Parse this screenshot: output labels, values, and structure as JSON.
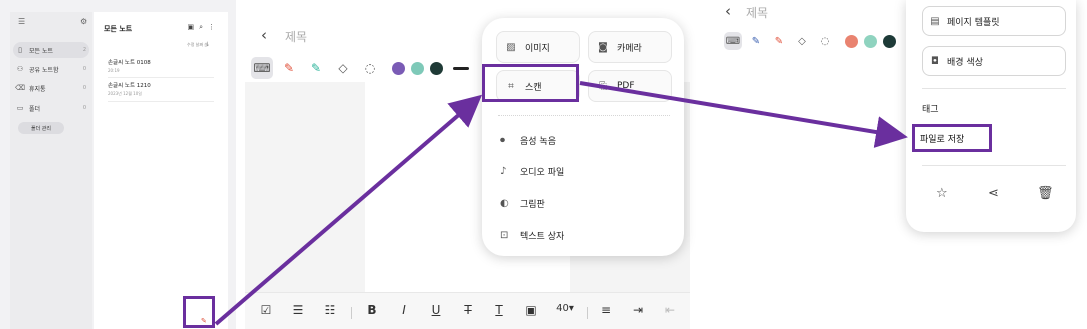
{
  "colors": {
    "highlight": "#6a2f9e",
    "pen_red": "#e0503a",
    "pen_green": "#2bb39a",
    "purple": "#7a5bb5",
    "teal": "#7ec9b8",
    "dark": "#1f3a36",
    "salmon": "#e98370",
    "mint": "#8fd3bf",
    "darkteal": "#1d3a37"
  },
  "panel1": {
    "sidebar": {
      "items": [
        {
          "label": "모든 노트",
          "count": "2",
          "icon": "note-icon"
        },
        {
          "label": "공유 노트함",
          "count": "0",
          "icon": "people-icon"
        },
        {
          "label": "휴지통",
          "count": "0",
          "icon": "trash-icon"
        },
        {
          "label": "폴더",
          "count": "0",
          "icon": "folder-icon"
        }
      ],
      "folder_manage": "폴더 관리"
    },
    "list": {
      "title": "모든 노트",
      "sort_label": "수정 날짜 순",
      "notes": [
        {
          "title": "손글씨 노트 0108",
          "date": "20:19"
        },
        {
          "title": "손글씨 노트 1210",
          "date": "2023년 12월 10일"
        }
      ]
    }
  },
  "panel2": {
    "title_placeholder": "제목",
    "menu": {
      "image": "이미지",
      "camera": "카메라",
      "scan": "스캔",
      "pdf": "PDF",
      "voice": "음성 녹음",
      "audio_file": "오디오 파일",
      "drawing": "그림판",
      "text_box": "텍스트 상자"
    },
    "font_size": "40"
  },
  "panel3": {
    "title_placeholder": "제목",
    "menu": {
      "page_template": "페이지 템플릿",
      "bg_color": "배경 색상",
      "tag": "태그",
      "save_as_file": "파일로 저장"
    }
  }
}
